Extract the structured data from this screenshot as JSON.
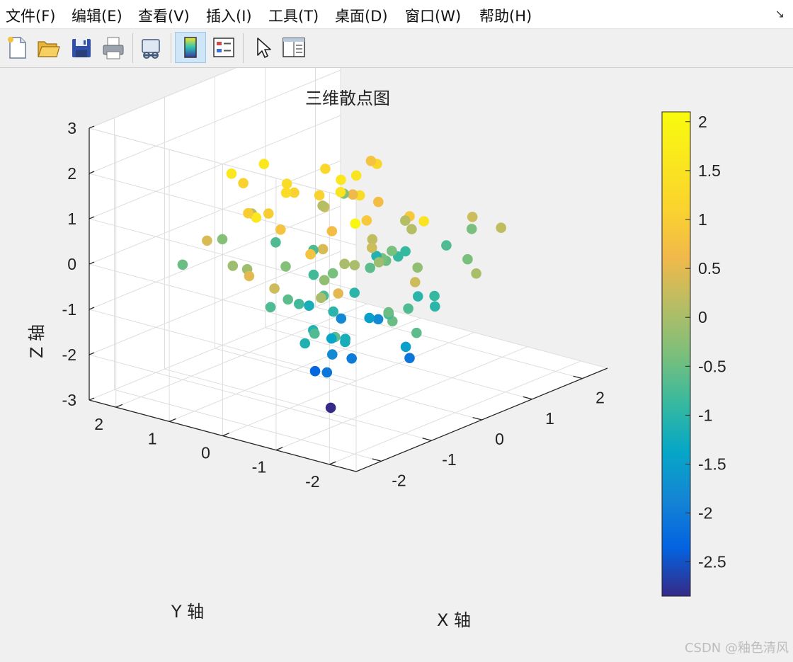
{
  "menu": [
    "文件(F)",
    "编辑(E)",
    "查看(V)",
    "插入(I)",
    "工具(T)",
    "桌面(D)",
    "窗口(W)",
    "帮助(H)"
  ],
  "menu_expand_glyph": "↘",
  "toolbar": [
    "new-file-icon",
    "open-folder-icon",
    "save-icon",
    "print-icon",
    "link-plot-icon",
    "insert-colorbar-icon",
    "insert-legend-icon",
    "pointer-icon",
    "property-inspector-icon"
  ],
  "watermark": "CSDN @釉色清风",
  "chart_data": {
    "type": "scatter3d",
    "title": "三维散点图",
    "xlabel": "X 轴",
    "ylabel": "Y 轴",
    "zlabel": "Z 轴",
    "xlim": [
      -2.5,
      2.5
    ],
    "ylim": [
      -2.5,
      2.5
    ],
    "zlim": [
      -3,
      3
    ],
    "xticks": [
      -2,
      -1,
      0,
      1,
      2
    ],
    "yticks": [
      -2,
      -1,
      0,
      1,
      2
    ],
    "zticks": [
      -3,
      -2,
      -1,
      0,
      1,
      2,
      3
    ],
    "xtick_labels": [
      "-2",
      "-1",
      "0",
      "1",
      "2"
    ],
    "ytick_labels": [
      "-2",
      "-1",
      "0",
      "1",
      "2"
    ],
    "ztick_labels": [
      "-3",
      "-2",
      "-1",
      "0",
      "1",
      "2",
      "3"
    ],
    "grid": true,
    "view": "default 3-D (azimuth -37.5°, elevation 30°)",
    "colormap": "parula",
    "color_by": "z",
    "colorbar": {
      "range": [
        -2.85,
        2.1
      ],
      "ticks": [
        -2.5,
        -2,
        -1.5,
        -1,
        -0.5,
        0,
        0.5,
        1,
        1.5,
        2
      ],
      "tick_labels": [
        "-2.5",
        "-2",
        "-1.5",
        "-1",
        "-0.5",
        "0",
        "0.5",
        "1",
        "1.5",
        "2"
      ]
    },
    "points": [
      [
        1.53,
        -1.42,
        0.2
      ],
      [
        -0.18,
        -0.03,
        1.6
      ],
      [
        -0.61,
        -1.99,
        1.5
      ],
      [
        1.67,
        1.15,
        0.8
      ],
      [
        0.62,
        1.03,
        0.3
      ],
      [
        -1.67,
        -1.06,
        0.0
      ],
      [
        0.47,
        -1.17,
        -0.9
      ],
      [
        -0.01,
        1.8,
        0.2
      ],
      [
        -0.45,
        -1.5,
        -1.5
      ],
      [
        -0.81,
        -0.14,
        -2.3
      ],
      [
        0.01,
        0.66,
        -0.8
      ],
      [
        0.66,
        0.06,
        0.7
      ],
      [
        -1.02,
        -0.56,
        -2.1
      ],
      [
        -1.91,
        -1.55,
        -0.6
      ],
      [
        -1.09,
        0.85,
        1.0
      ],
      [
        -0.55,
        -0.58,
        -2.0
      ],
      [
        -0.2,
        -0.63,
        0.3
      ],
      [
        1.14,
        -1.16,
        -0.4
      ],
      [
        -1.09,
        -0.97,
        -1.2
      ],
      [
        -0.33,
        -0.02,
        -0.4
      ],
      [
        -1.05,
        0.28,
        0.8
      ],
      [
        -1.54,
        -0.74,
        0.8
      ],
      [
        -0.33,
        2.05,
        -0.3
      ],
      [
        -0.49,
        -0.39,
        0.0
      ],
      [
        0.5,
        -0.16,
        -0.4
      ],
      [
        -1.41,
        0.13,
        -0.7
      ],
      [
        0.05,
        -1.1,
        -2.1
      ],
      [
        -1.15,
        -2.36,
        -0.6
      ],
      [
        -0.32,
        0.85,
        1.3
      ],
      [
        0.59,
        -0.15,
        -0.5
      ],
      [
        -0.41,
        -0.24,
        1.5
      ],
      [
        -1.95,
        -0.11,
        1.6
      ],
      [
        0.26,
        -2.15,
        0.0
      ],
      [
        0.22,
        -0.94,
        0.9
      ],
      [
        -1.88,
        -1.9,
        2.0
      ],
      [
        -0.63,
        0.58,
        -0.3
      ],
      [
        2.06,
        -0.37,
        -0.4
      ],
      [
        0.18,
        -0.28,
        0.2
      ],
      [
        1.55,
        0.39,
        -0.9
      ],
      [
        1.78,
        -0.16,
        -0.7
      ],
      [
        -0.37,
        -1.47,
        -0.7
      ],
      [
        0.07,
        -0.05,
        -1.0
      ],
      [
        -0.87,
        -2.07,
        0.3
      ],
      [
        1.45,
        0.84,
        -1.1
      ],
      [
        -1.84,
        -1.1,
        -0.7
      ],
      [
        -1.03,
        -0.64,
        -2.85
      ],
      [
        0.53,
        1.86,
        -0.7
      ],
      [
        0.54,
        -0.05,
        -1.8
      ],
      [
        0.2,
        0.04,
        1.5
      ],
      [
        -0.96,
        0.02,
        -0.8
      ],
      [
        0.91,
        1.34,
        0.1
      ],
      [
        -0.38,
        1.61,
        1.1
      ],
      [
        1.49,
        -0.92,
        0.3
      ],
      [
        -0.4,
        0.36,
        -1.2
      ],
      [
        -1.67,
        -0.76,
        -1.1
      ],
      [
        -1.28,
        0.69,
        -0.1
      ],
      [
        0.55,
        0.95,
        1.2
      ],
      [
        -0.56,
        -0.22,
        0.7
      ],
      [
        -1.12,
        2.05,
        -0.5
      ],
      [
        0.92,
        -0.32,
        0.1
      ],
      [
        -1.18,
        -1.05,
        -1.2
      ],
      [
        0.24,
        -1.07,
        -0.2
      ],
      [
        0.39,
        -0.04,
        -0.6
      ],
      [
        -0.59,
        0.61,
        1.3
      ],
      [
        0.11,
        -0.29,
        -1.5
      ],
      [
        -0.85,
        -0.5,
        -1.8
      ],
      [
        -2.26,
        -0.27,
        0.5
      ],
      [
        -0.14,
        0.41,
        1.1
      ],
      [
        -1.22,
        -0.49,
        -1.1
      ],
      [
        1.12,
        -0.01,
        0.1
      ],
      [
        1.96,
        1.93,
        -0.3
      ],
      [
        0.79,
        -0.07,
        -0.4
      ],
      [
        -0.24,
        -0.57,
        0.9
      ],
      [
        -1.18,
        0.02,
        -0.6
      ],
      [
        -0.9,
        -1.6,
        -0.5
      ],
      [
        -0.76,
        -0.24,
        0.4
      ],
      [
        0.6,
        1.22,
        -0.7
      ],
      [
        0.27,
        0.39,
        -1.8
      ],
      [
        -1.42,
        1.31,
        0.4
      ],
      [
        -0.86,
        1.38,
        1.6
      ],
      [
        -0.26,
        0.77,
        1.1
      ],
      [
        -0.56,
        -1.28,
        -0.8
      ],
      [
        -0.09,
        -0.3,
        1.3
      ],
      [
        -0.66,
        -0.16,
        -0.7
      ],
      [
        0.81,
        0.68,
        0.6
      ],
      [
        -1.13,
        -1.89,
        -0.5
      ],
      [
        -0.92,
        -0.55,
        -1.4
      ],
      [
        0.3,
        -1.34,
        -1.0
      ],
      [
        -0.45,
        -0.54,
        0.0
      ],
      [
        -0.32,
        1.28,
        1.6
      ],
      [
        1.1,
        0.5,
        1.2
      ],
      [
        -0.65,
        -0.33,
        -1.0
      ],
      [
        -0.94,
        0.61,
        1.0
      ],
      [
        -2.07,
        -1.76,
        0.5
      ],
      [
        -1.29,
        0.95,
        -0.1
      ],
      [
        -0.04,
        -0.61,
        -0.1
      ],
      [
        -2.16,
        -0.65,
        0.3
      ],
      [
        0.46,
        -0.87,
        -1.0
      ],
      [
        -0.86,
        -0.36,
        -0.2
      ],
      [
        1.34,
        0.33,
        -0.9
      ]
    ]
  }
}
